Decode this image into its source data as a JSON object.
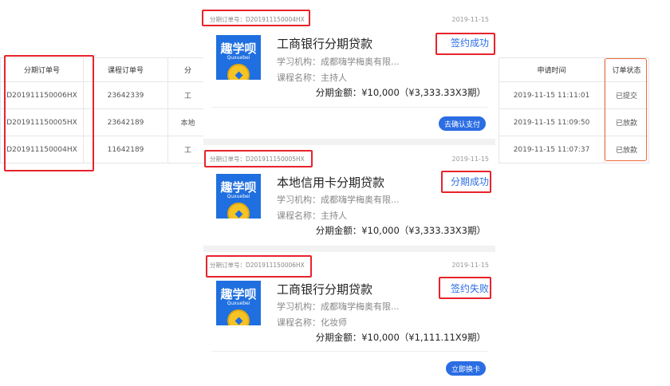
{
  "left_table": {
    "headers": [
      "分期订单号",
      "课程订单号",
      "分"
    ],
    "rows": [
      [
        "D201911150006HX",
        "23642339",
        "工"
      ],
      [
        "D201911150005HX",
        "23642189",
        "本地"
      ],
      [
        "D201911150004HX",
        "11642189",
        "工"
      ]
    ]
  },
  "right_table": {
    "headers": [
      "申请时间",
      "订单状态"
    ],
    "rows": [
      [
        "2019-11-15 11:11:01",
        "已提交"
      ],
      [
        "2019-11-15 11:09:50",
        "已放款"
      ],
      [
        "2019-11-15 11:07:37",
        "已放款"
      ]
    ]
  },
  "logo": {
    "text": "趣学呗",
    "sub": "Quxuebei"
  },
  "colors": {
    "brand_blue": "#2b6de3",
    "highlight_red": "#e8232b",
    "highlight_orange": "#f06a3c"
  },
  "cards": [
    {
      "order_id": "分期订单号：D201911150004HX",
      "date": "2019-11-15",
      "title": "工商银行分期贷款",
      "status": "签约成功",
      "institution": "学习机构：成都嗨学梅奥有限...",
      "course": "课程名称：主持人",
      "amount": "分期金额：¥10,000（¥3,333.33X3期）",
      "button": "去确认支付"
    },
    {
      "order_id": "分期订单号：D201911150005HX",
      "date": "2019-11-15",
      "title": "本地信用卡分期贷款",
      "status": "分期成功",
      "institution": "学习机构：成都嗨学梅奥有限...",
      "course": "课程名称：主持人",
      "amount": "分期金额：¥10,000（¥3,333.33X3期）"
    },
    {
      "order_id": "分期订单号：D201911150006HX",
      "date": "2019-11-15",
      "title": "工商银行分期贷款",
      "status": "签约失败",
      "institution": "学习机构：成都嗨学梅奥有限...",
      "course": "课程名称：化妆师",
      "amount": "分期金额：¥10,000（¥1,111.11X9期）",
      "button": "立即换卡"
    }
  ]
}
